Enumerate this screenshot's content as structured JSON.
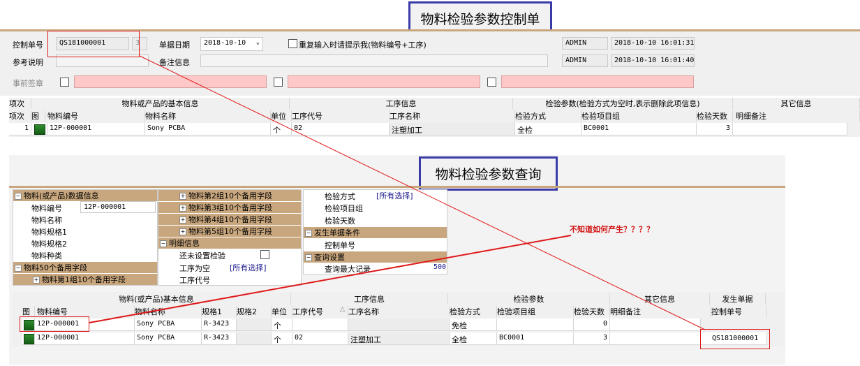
{
  "top": {
    "title": "物料检验参数控制单",
    "control_no_label": "控制单号",
    "control_no_value": "QS181000001",
    "control_no_suffix": "3",
    "date_label": "单据日期",
    "date_value": "2018-10-10",
    "repeat_prompt_label": "重复输入时请提示我(物料编号+工序)",
    "user1": "ADMIN",
    "time1": "2018-10-10 16:01:31",
    "ref_label": "参考说明",
    "remark_label": "备注信息",
    "user2": "ADMIN",
    "time2": "2018-10-10 16:01:40",
    "presign_label": "事前签章",
    "grid": {
      "group_headers": [
        "项次",
        "物料或产品的基本信息",
        "工序信息",
        "检验参数(检验方式为空时,表示删除此项信息)",
        "其它信息"
      ],
      "col_headers": [
        "项次",
        "图",
        "物料编号",
        "物料名称",
        "单位",
        "工序代号",
        "工序名称",
        "检验方式",
        "检验项目组",
        "检验天数",
        "明细备注"
      ],
      "row": {
        "seq": "1",
        "item_no": "12P-000001",
        "item_name": "Sony PCBA",
        "unit": "个",
        "proc_code": "02",
        "proc_name": "注塑加工",
        "method": "全检",
        "group": "BC0001",
        "days": "3",
        "note": ""
      }
    }
  },
  "bottom": {
    "title": "物料检验参数查询",
    "tree1": {
      "sec1": "物料(或产品)数据信息",
      "item_no_label": "物料编号",
      "item_no_value": "12P-000001",
      "item_name_label": "物料名称",
      "spec1_label": "物料规格1",
      "spec2_label": "物料规格2",
      "kind_label": "物料种类",
      "sec2": "物料50个备用字段",
      "sub1": "物料第1组10个备用字段"
    },
    "tree2": {
      "sub2": "物料第2组10个备用字段",
      "sub3": "物料第3组10个备用字段",
      "sub4": "物料第4组10个备用字段",
      "sub5": "物料第5组10个备用字段",
      "sec_detail": "明细信息",
      "unset_label": "还未设置检验",
      "proc_empty_label": "工序为空",
      "proc_empty_value": "[所有选择]",
      "proc_code_label": "工序代号"
    },
    "tree3": {
      "method_label": "检验方式",
      "method_value": "[所有选择]",
      "group_label": "检验项目组",
      "days_label": "检验天数",
      "sec_doc": "发生单据条件",
      "control_label": "控制单号",
      "sec_query": "查询设置",
      "max_label": "查询最大记录",
      "max_value": "500"
    },
    "note": "不知道如何产生？？？？",
    "grid": {
      "group_headers": [
        "物料(或产品)基本信息",
        "工序信息",
        "检验参数",
        "其它信息",
        "发生单据"
      ],
      "col_headers": [
        "图",
        "物料编号",
        "物料名称",
        "规格1",
        "规格2",
        "单位",
        "工序代号",
        "△",
        "工序名称",
        "检验方式",
        "检验项目组",
        "检验天数",
        "明细备注",
        "控制单号"
      ],
      "rows": [
        {
          "item_no": "12P-000001",
          "item_name": "Sony PCBA",
          "spec1": "R-3423",
          "unit": "个",
          "proc_code": "",
          "proc_name": "",
          "method": "免检",
          "group": "",
          "days": "0",
          "note": "",
          "ctrl": ""
        },
        {
          "item_no": "12P-000001",
          "item_name": "Sony PCBA",
          "spec1": "R-3423",
          "unit": "个",
          "proc_code": "02",
          "proc_name": "注塑加工",
          "method": "全检",
          "group": "BC0001",
          "days": "3",
          "note": "",
          "ctrl": "QS181000001"
        }
      ]
    }
  },
  "colors": {
    "title_border": "#3b3ba8",
    "section": "#c9a77e",
    "annotation": "#d21414",
    "pink": "#ffc8c8"
  }
}
